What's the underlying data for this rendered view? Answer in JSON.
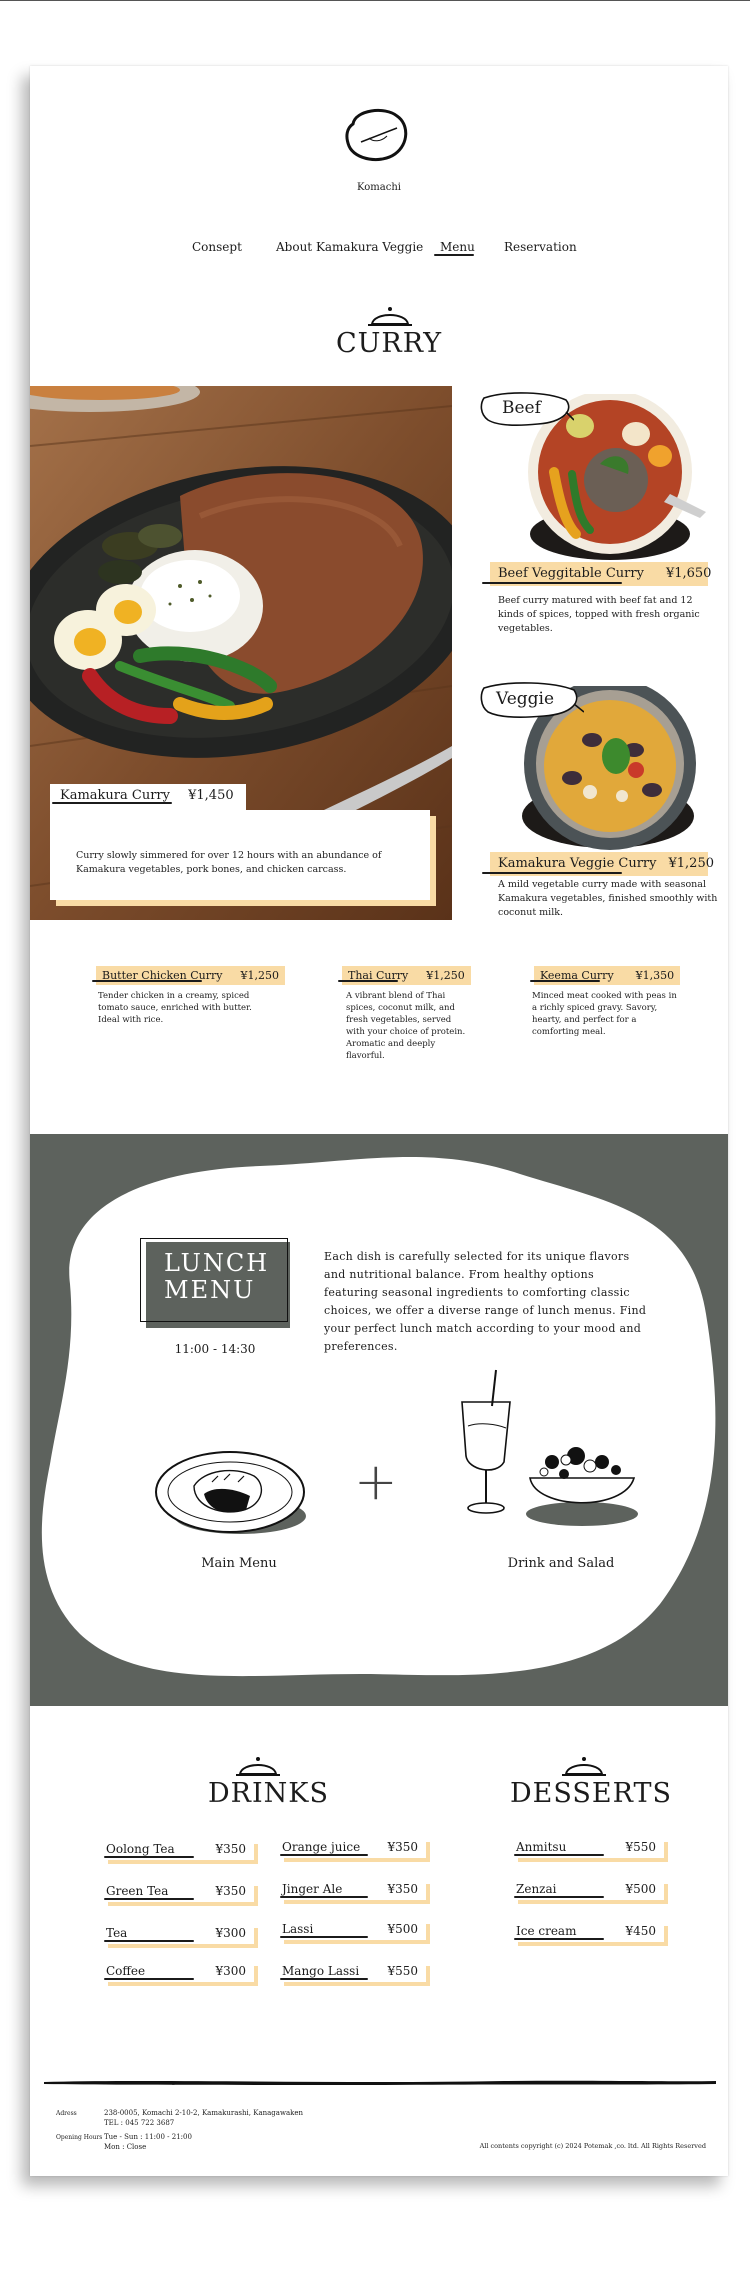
{
  "brand": {
    "name": "Komachi"
  },
  "nav": {
    "items": [
      {
        "label": "Consept"
      },
      {
        "label": "About Kamakura Veggie"
      },
      {
        "label": "Menu"
      },
      {
        "label": "Reservation"
      }
    ]
  },
  "curry": {
    "title": "CURRY",
    "featured": {
      "name": "Kamakura Curry",
      "price": "¥1,450",
      "description": "Curry slowly simmered for over 12 hours with an abundance of Kamakura vegetables, pork bones, and chicken carcass."
    },
    "beef": {
      "tag": "Beef",
      "name": "Beef Veggitable Curry",
      "price": "¥1,650",
      "description": "Beef curry matured with beef fat and 12 kinds of spices, topped with fresh organic vegetables."
    },
    "veggie": {
      "tag": "Veggie",
      "name": "Kamakura Veggie Curry",
      "price": "¥1,250",
      "description": "A mild vegetable curry made with seasonal Kamakura vegetables, finished smoothly with coconut milk."
    },
    "others": [
      {
        "name": "Butter Chicken Curry",
        "price": "¥1,250",
        "description": "Tender chicken in a creamy, spiced tomato sauce, enriched with butter. Ideal with rice."
      },
      {
        "name": "Thai Curry",
        "price": "¥1,250",
        "description": "A vibrant blend of Thai spices, coconut milk, and fresh vegetables, served with your choice of protein. Aromatic and deeply flavorful."
      },
      {
        "name": "Keema Curry",
        "price": "¥1,350",
        "description": "Minced meat cooked with peas in a richly spiced gravy. Savory, hearty, and perfect for a comforting meal."
      }
    ]
  },
  "lunch": {
    "title_line1": "LUNCH",
    "title_line2": "MENU",
    "hours": "11:00 - 14:30",
    "description": "Each dish is carefully selected for its unique flavors and nutritional balance. From healthy options featuring seasonal ingredients to comforting classic choices, we offer a diverse range of lunch menus. Find your perfect lunch match according to your mood and preferences.",
    "main_label": "Main Menu",
    "plus": "+",
    "drink_label": "Drink and Salad"
  },
  "drinks": {
    "title": "DRINKS",
    "col1": [
      {
        "name": "Oolong Tea",
        "price": "¥350"
      },
      {
        "name": "Green Tea",
        "price": "¥350"
      },
      {
        "name": "Tea",
        "price": "¥300"
      },
      {
        "name": "Coffee",
        "price": "¥300"
      }
    ],
    "col2": [
      {
        "name": "Orange juice",
        "price": "¥350"
      },
      {
        "name": "Jinger Ale",
        "price": "¥350"
      },
      {
        "name": "Lassi",
        "price": "¥500"
      },
      {
        "name": "Mango Lassi",
        "price": "¥550"
      }
    ]
  },
  "desserts": {
    "title": "DESSERTS",
    "items": [
      {
        "name": "Anmitsu",
        "price": "¥550"
      },
      {
        "name": "Zenzai",
        "price": "¥500"
      },
      {
        "name": "Ice cream",
        "price": "¥450"
      }
    ]
  },
  "footer": {
    "address_label": "Adress",
    "address_line1": "238-0005, Komachi 2-10-2, Kamakurashi, Kanagawaken",
    "address_line2": "TEL : 045 722 3687",
    "hours_label": "Opening Hours",
    "hours_line1": "Tue - Sun : 11:00 - 21:00",
    "hours_line2": "Mon : Close",
    "copyright": "All contents copyright (c) 2024 Potemak ,co. ltd. All Rights Reserved"
  },
  "colors": {
    "accent": "#f9dba5",
    "dark_band": "#5d625d",
    "ink": "#1b1b1b"
  }
}
